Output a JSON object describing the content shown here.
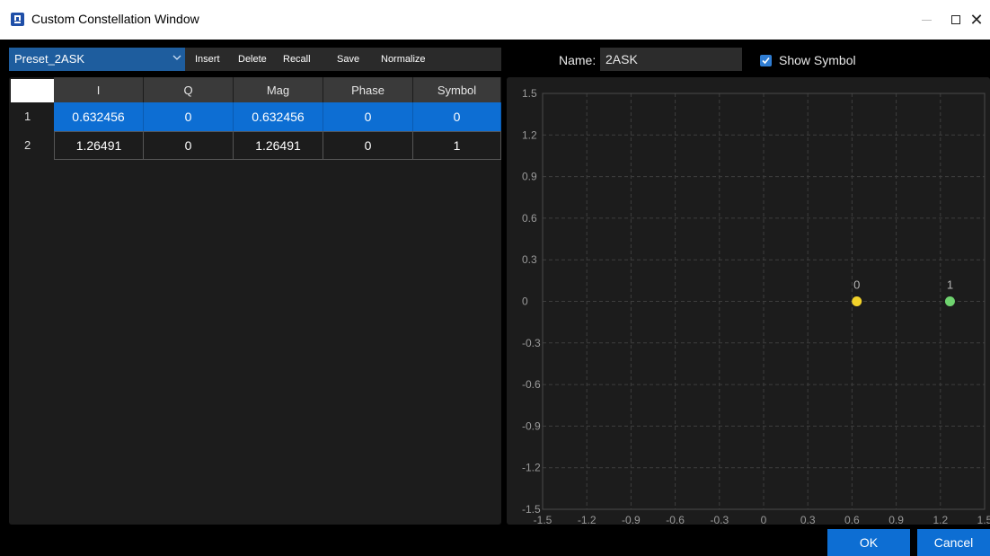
{
  "window": {
    "title": "Custom Constellation Window"
  },
  "toolbar": {
    "preset_value": "Preset_2ASK",
    "buttons": [
      "Insert",
      "Delete",
      "Recall",
      "Save",
      "Normalize"
    ]
  },
  "name_field": {
    "label": "Name:",
    "value": "2ASK"
  },
  "show_symbol": {
    "label": "Show Symbol",
    "checked": true
  },
  "table": {
    "columns": [
      "I",
      "Q",
      "Mag",
      "Phase",
      "Symbol"
    ],
    "rows": [
      {
        "num": "1",
        "cells": [
          "0.632456",
          "0",
          "0.632456",
          "0",
          "0"
        ],
        "selected": true
      },
      {
        "num": "2",
        "cells": [
          "1.26491",
          "0",
          "1.26491",
          "0",
          "1"
        ],
        "selected": false
      }
    ]
  },
  "chart_data": {
    "type": "scatter",
    "xlim": [
      -1.5,
      1.5
    ],
    "ylim": [
      -1.5,
      1.5
    ],
    "grid": true,
    "x_ticks": [
      "-1.5",
      "-1.2",
      "-0.9",
      "-0.6",
      "-0.3",
      "0",
      "0.3",
      "0.6",
      "0.9",
      "1.2",
      "1.5"
    ],
    "y_ticks": [
      "1.5",
      "1.2",
      "0.9",
      "0.6",
      "0.3",
      "0",
      "-0.3",
      "-0.6",
      "-0.9",
      "-1.2",
      "-1.5"
    ],
    "points": [
      {
        "x": 0.632456,
        "y": 0,
        "label": "0",
        "color": "#f2d22a"
      },
      {
        "x": 1.26491,
        "y": 0,
        "label": "1",
        "color": "#6fd36f"
      }
    ]
  },
  "footer": {
    "ok_label": "OK",
    "cancel_label": "Cancel"
  },
  "colors": {
    "accent": "#0d6ed3",
    "panel": "#1c1c1c",
    "grid": "#3c3c3c"
  }
}
